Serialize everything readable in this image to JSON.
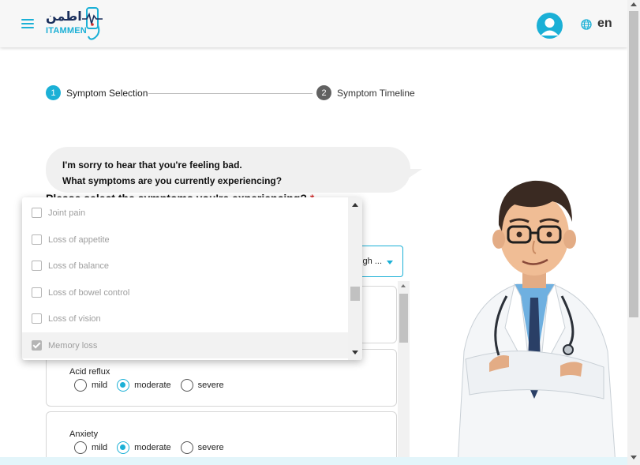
{
  "header": {
    "logo_latin": "ITAMMEN",
    "logo_arabic": "اطمن",
    "language": "en",
    "icons": {
      "menu": "hamburger-menu-icon",
      "avatar": "user-avatar-icon",
      "globe": "globe-icon"
    },
    "colors": {
      "accent": "#1bb0d6",
      "logo_dark": "#1a2f5c"
    }
  },
  "stepper": {
    "steps": [
      {
        "number": "1",
        "label": "Symptom Selection",
        "active": true
      },
      {
        "number": "2",
        "label": "Symptom Timeline",
        "active": false
      }
    ]
  },
  "chat": {
    "line1": "I'm sorry to hear that you're feeling bad.",
    "line2": "What symptoms are you currently experiencing?"
  },
  "form": {
    "question": "Please select the symptoms you're experiencing?",
    "required_mark": "*",
    "select_value": "ugh ..."
  },
  "dropdown": {
    "options": [
      {
        "label": "Joint pain",
        "checked": false
      },
      {
        "label": "Loss of appetite",
        "checked": false
      },
      {
        "label": "Loss of balance",
        "checked": false
      },
      {
        "label": "Loss of bowel control",
        "checked": false
      },
      {
        "label": "Loss of vision",
        "checked": false
      },
      {
        "label": "Memory loss",
        "checked": true
      }
    ]
  },
  "severity_cards": [
    {
      "symptom": "",
      "selected": ""
    },
    {
      "symptom": "Acid reflux",
      "selected": "moderate"
    },
    {
      "symptom": "Anxiety",
      "selected": "moderate"
    }
  ],
  "severity_options": [
    "mild",
    "moderate",
    "severe"
  ]
}
